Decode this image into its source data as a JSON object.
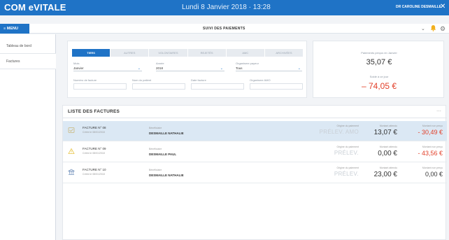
{
  "header": {
    "app_title": "COM eVITALE",
    "date": "Lundi 8 Janvier 2018 · 13:28",
    "user": "DR CAROLINE DESMAILLE"
  },
  "toolbar": {
    "menu_label": "≡ MENU",
    "page_title": "SUIVI DES PAIEMENTS"
  },
  "sidebar": {
    "items": [
      {
        "label": "Tableau de bord"
      },
      {
        "label": "Factures"
      }
    ]
  },
  "filters": {
    "tabs": [
      "TIERS",
      "AUTRES",
      "VOLONTAIRES",
      "REJETÉS",
      "AMC",
      "ARCHIVÉES"
    ],
    "active_tab": 0,
    "mois_label": "Mois",
    "mois_value": "Janvier",
    "annee_label": "Année",
    "annee_value": "2018",
    "organisme_label": "Organisme payeur",
    "organisme_value": "Tous",
    "field1_label": "Numéro de facture",
    "field2_label": "Nom du patient",
    "field3_label": "Date facture",
    "field4_label": "Organisme AMO"
  },
  "totals": {
    "paid_label": "Paiements perçus en Janvier",
    "paid_value": "35,07 €",
    "balance_label": "Solde à ce jour",
    "balance_value": "– 74,05 €"
  },
  "invoices": {
    "title": "LISTE DES FACTURES",
    "rows": [
      {
        "number": "FACTURE N° 08",
        "date": "Créée le 08/01/2018",
        "beneficiary_label": "Bénéficiaire",
        "beneficiary": "DESMAILLE NATHALIE",
        "status_label": "Origine du paiement",
        "status": "PRÉLEV. AMO",
        "amount_label": "Montant attendu",
        "amount": "13,07 €",
        "diff_label": "Montant non perçu",
        "diff": "- 30,49 €",
        "diff_negative": true,
        "selected": true,
        "icon": "document-check-icon"
      },
      {
        "number": "FACTURE N° 09",
        "date": "Créée le 08/01/2018",
        "beneficiary_label": "Bénéficiaire",
        "beneficiary": "DESMAILLE PAUL",
        "status_label": "Origine du paiement",
        "status": "PRÉLEV.",
        "amount_label": "Montant attendu",
        "amount": "0,00 €",
        "diff_label": "Montant non perçu",
        "diff": "- 43,56 €",
        "diff_negative": true,
        "selected": false,
        "icon": "warning-icon"
      },
      {
        "number": "FACTURE N° 10",
        "date": "Créée le 08/01/2018",
        "beneficiary_label": "Bénéficiaire",
        "beneficiary": "DESMAILLE NATHALIE",
        "status_label": "Origine du paiement",
        "status": "PRÉLEV.",
        "amount_label": "Montant attendu",
        "amount": "23,00 €",
        "diff_label": "Montant non perçu",
        "diff": "0,00 €",
        "diff_negative": false,
        "selected": false,
        "icon": "bank-icon"
      }
    ]
  },
  "colors": {
    "brand": "#1f73c6",
    "negative": "#e2402a",
    "selected_row": "#dbe8f4"
  }
}
